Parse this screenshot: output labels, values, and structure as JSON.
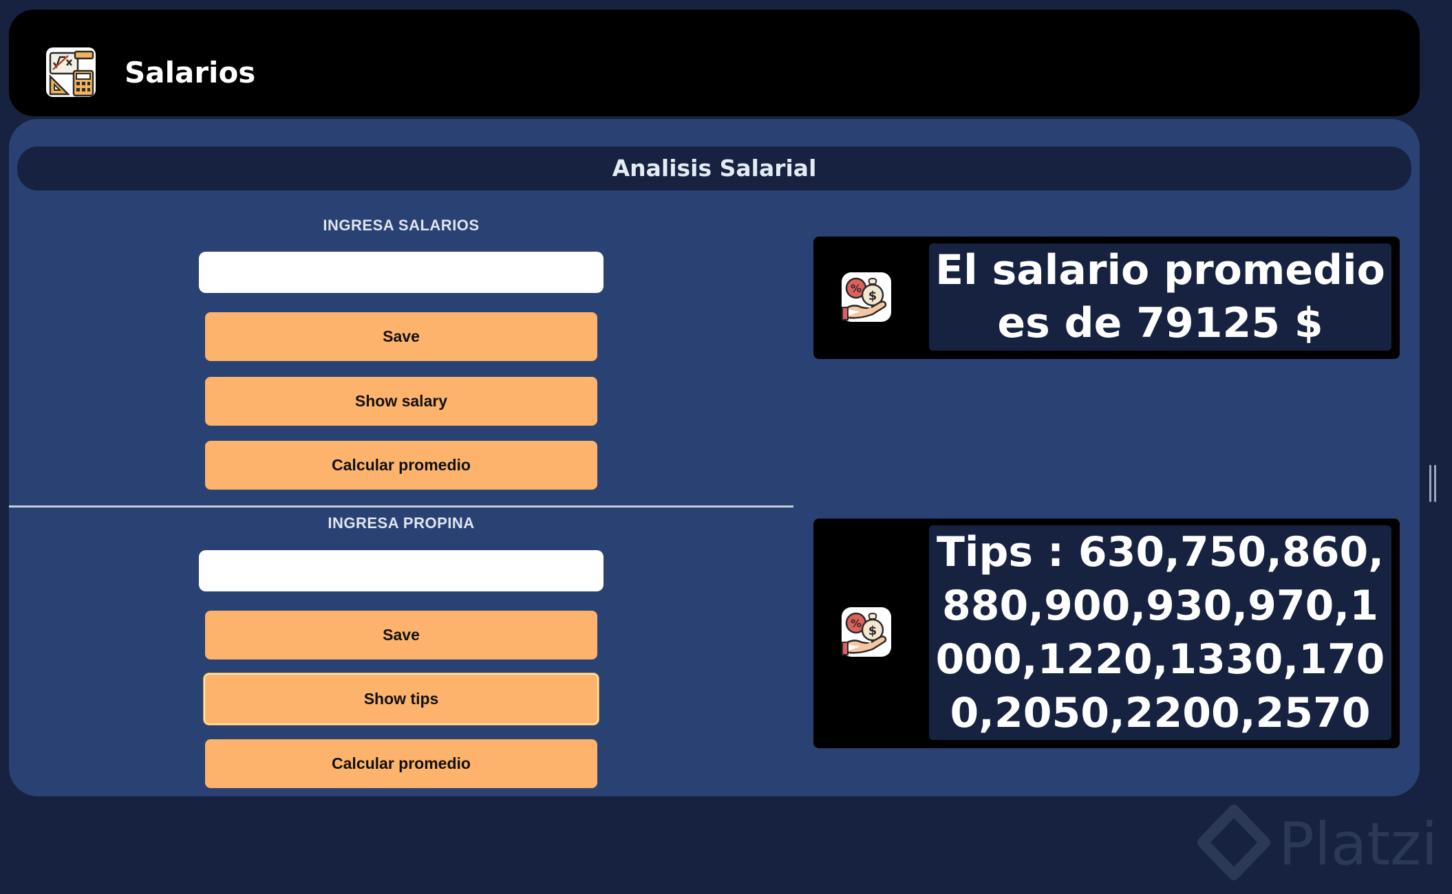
{
  "header": {
    "logo_icon": "calculator-math-icon",
    "title": "Salarios"
  },
  "section": {
    "title": "Analisis Salarial"
  },
  "salary_form": {
    "label": "INGRESA SALARIOS",
    "input_value": "",
    "save_label": "Save",
    "show_label": "Show salary",
    "average_label": "Calcular promedio"
  },
  "tips_form": {
    "label": "INGRESA PROPINA",
    "input_value": "",
    "save_label": "Save",
    "show_label": "Show tips",
    "average_label": "Calcular promedio"
  },
  "salary_result": {
    "icon": "money-bag-hand-icon",
    "text": "El salario promedio es de 79125 $"
  },
  "tips_result": {
    "icon": "money-bag-hand-icon",
    "text": "Tips : 630,750,860,880,900,930,970,1000,1220,1330,1700,2050,2200,2570"
  },
  "watermark": {
    "text": "Platzi"
  },
  "colors": {
    "background": "#16223f",
    "panel": "#2a4273",
    "header": "#000000",
    "button": "#fdb36b",
    "result_box": "#16223f"
  }
}
